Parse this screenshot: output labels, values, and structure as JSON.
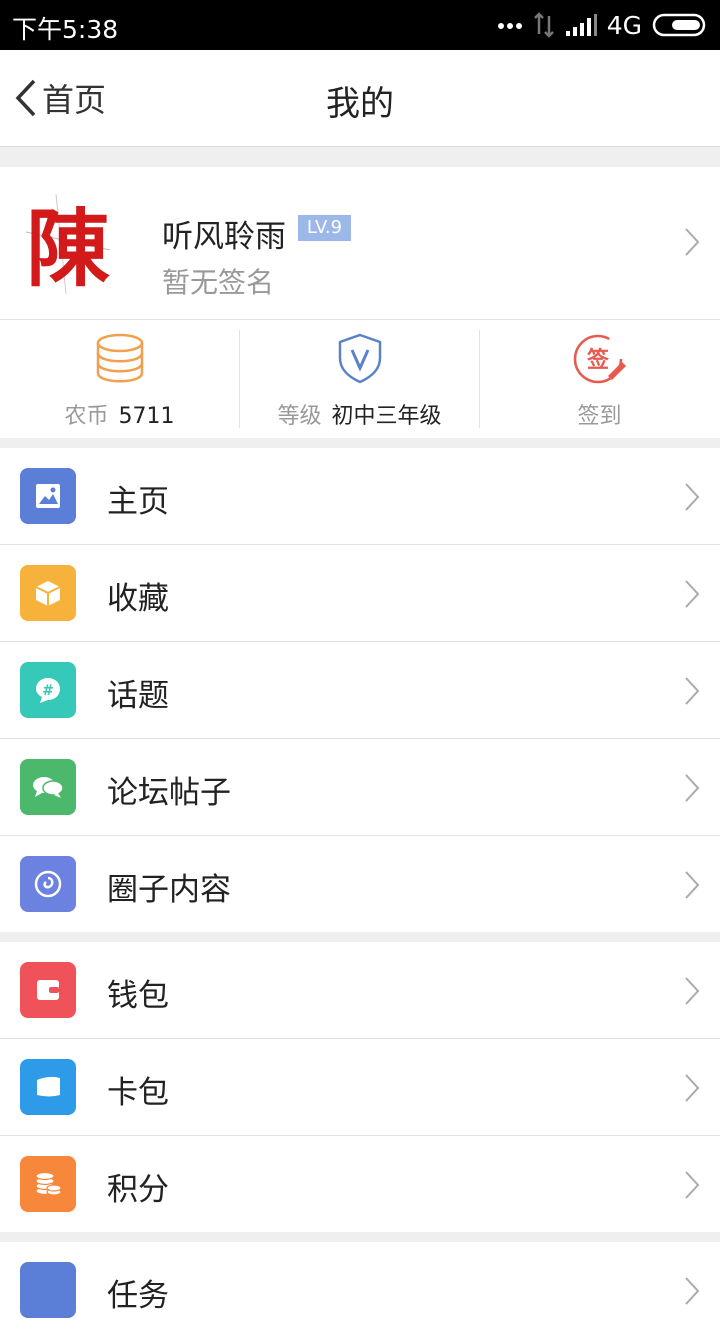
{
  "status_bar": {
    "time": "下午5:38",
    "network": "4G"
  },
  "nav": {
    "back_label": "首页",
    "title": "我的"
  },
  "profile": {
    "name": "听风聆雨",
    "level_badge": "LV.9",
    "signature": "暂无签名",
    "avatar_char": "陳"
  },
  "stats": [
    {
      "label": "农币",
      "value": "5711",
      "icon": "coins-icon",
      "color": "#f0a050"
    },
    {
      "label": "等级",
      "value": "初中三年级",
      "icon": "shield-v-icon",
      "color": "#5b82c8"
    },
    {
      "label": "签到",
      "value": "",
      "icon": "sign-in-icon",
      "color": "#e85a50"
    }
  ],
  "groups": [
    [
      {
        "label": "主页",
        "icon": "image-icon",
        "color": "#5b7fd6"
      },
      {
        "label": "收藏",
        "icon": "box-icon",
        "color": "#f7b23b"
      },
      {
        "label": "话题",
        "icon": "hashtag-chat-icon",
        "color": "#36c9b9"
      },
      {
        "label": "论坛帖子",
        "icon": "chat-bubbles-icon",
        "color": "#4cb86b"
      },
      {
        "label": "圈子内容",
        "icon": "swirl-icon",
        "color": "#6b82e0"
      }
    ],
    [
      {
        "label": "钱包",
        "icon": "wallet-icon",
        "color": "#f0525a"
      },
      {
        "label": "卡包",
        "icon": "card-icon",
        "color": "#2d9be8"
      },
      {
        "label": "积分",
        "icon": "coins-stack-icon",
        "color": "#f7873a"
      }
    ],
    [
      {
        "label": "任务",
        "icon": "task-icon",
        "color": "#5b7fd6"
      }
    ]
  ]
}
